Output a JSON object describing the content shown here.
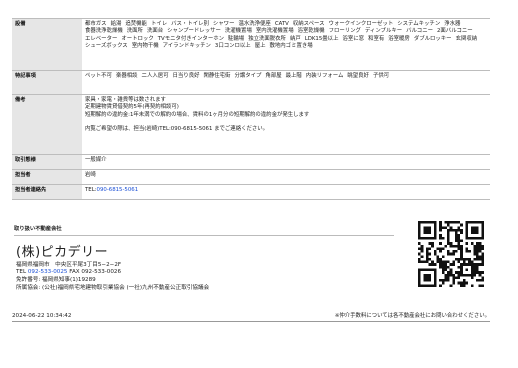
{
  "details": [
    {
      "label": "設備",
      "items": [
        "都市ガス",
        "給湯",
        "追焚機能",
        "トイレ",
        "バス・トイレ別",
        "シャワー",
        "温水洗浄便座",
        "CATV",
        "収納スペース",
        "ウォークインクローゼット",
        "システムキッチン",
        "浄水器",
        "食器洗浄乾燥機",
        "洗面所",
        "洗面台",
        "シャンプードレッサー",
        "洗濯機置場",
        "室内洗濯機置場",
        "浴室乾燥機",
        "フローリング",
        "ディンプルキー",
        "バルコニー",
        "2面バルコニー",
        "エレベーター",
        "オートロック",
        "TVモニタ付きインターホン",
        "駐輪場",
        "独立洗面脱衣所",
        "納戸",
        "LDK15畳以上",
        "浴室に窓",
        "和室有",
        "浴室暖房",
        "ダブルロッキー",
        "玄関収納",
        "シューズボックス",
        "室内物干機",
        "アイランドキッチン",
        "3口コンロ以上",
        "屋上",
        "敷地内ゴミ置き場"
      ]
    },
    {
      "label": "特記事項",
      "items": [
        "ペット不可",
        "楽器相談",
        "二人入居可",
        "日当り良好",
        "閑静住宅街",
        "分譲タイプ",
        "角部屋",
        "最上階",
        "内装リフォーム",
        "眺望良好",
        "子供可"
      ]
    },
    {
      "label": "備考",
      "lines": [
        "家具・家電・雑貨等は数されます",
        "定期建物賃貸借契約5年(再契約相談可)",
        "短期解約の違約金:1年未満での解約の場合、賃料の1ヶ月分の短期解約の違約金が発生します",
        "",
        "内覧ご希望の際は、担当(岩崎)TEL:090-6815-5061 までご連絡ください。"
      ]
    },
    {
      "label": "取引態様",
      "value": "一般媒介"
    },
    {
      "label": "担当者",
      "value": "岩崎"
    },
    {
      "label": "担当者連絡先",
      "value_prefix": "TEL:",
      "value_link": "090-6815-5061"
    }
  ],
  "company": {
    "section_label": "取り扱い不動産会社",
    "name": "(株)ピカデリー",
    "address": "福岡県福岡市　中央区平尾3丁目5−2−2F",
    "tel_label": "TEL",
    "tel": "092-533-0025",
    "fax": "FAX 092-533-0026",
    "license": "免許番号: 福岡県知事(1)19289",
    "association": "所属協会: (公社)福岡県宅地建物取引業協会 (一社)九州不動産公正取引協議会"
  },
  "footer": {
    "timestamp": "2024-06-22 10:34:42",
    "note": "※仲介手数料については各不動産会社にお問い合わせください。"
  }
}
